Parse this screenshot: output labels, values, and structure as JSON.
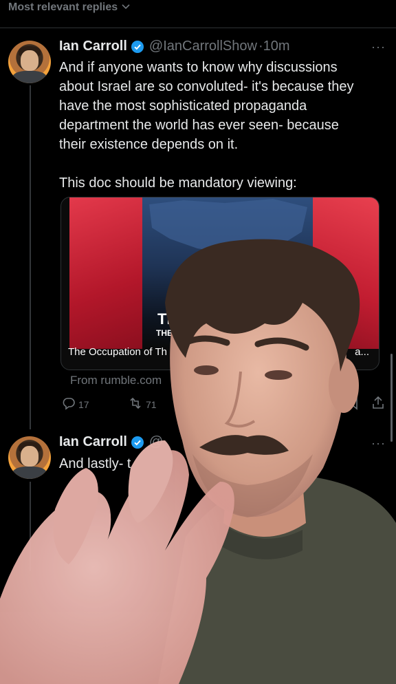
{
  "sort": {
    "label": "Most relevant replies"
  },
  "tweet1": {
    "name": "Ian Carroll",
    "handle": "@IanCarrollShow",
    "time": "·10m",
    "text_lines": [
      "And if anyone wants to know why discussions",
      "about Israel are so convoluted- it's because they",
      "have the most sophisticated propaganda",
      "department the world has ever seen- because",
      "their existence depends on it."
    ],
    "text_line2": "This doc should be mandatory viewing:",
    "card": {
      "big_text": "TI",
      "small_text": "THE",
      "caption": "The Occupation of Th",
      "caption_end": "a...",
      "source": "From rumble.com"
    },
    "actions": {
      "replies": "17",
      "reposts": "71"
    }
  },
  "tweet2": {
    "name": "Ian Carroll",
    "handle": "@",
    "text": "And lastly- t"
  },
  "colors": {
    "verified": "#1d9bf0",
    "muted": "#71767b",
    "background": "#000000"
  },
  "icons": [
    "chevron-down-icon",
    "verified-badge-icon",
    "more-icon",
    "reply-icon",
    "repost-icon",
    "share-icon",
    "bookmark-icon"
  ]
}
